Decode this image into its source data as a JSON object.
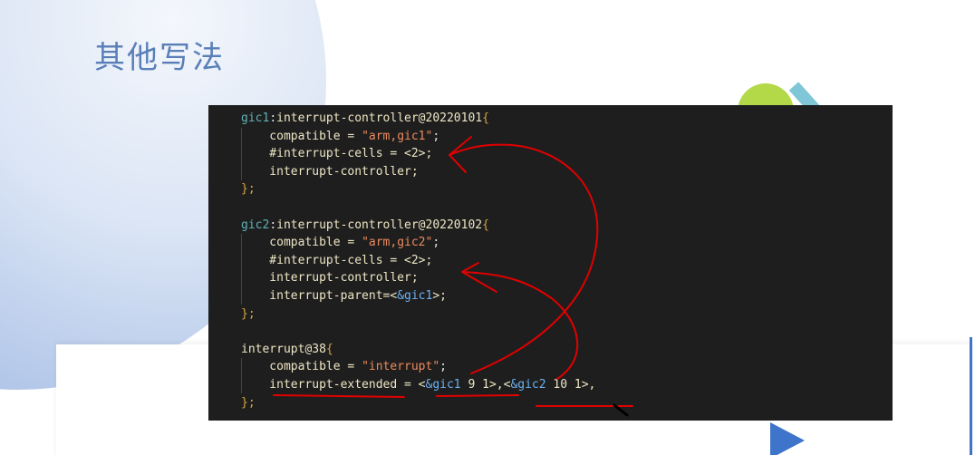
{
  "slide": {
    "title": "其他写法",
    "code": {
      "lines": [
        [
          [
            "name",
            "gic1"
          ],
          [
            "punc",
            ":"
          ],
          [
            "key",
            "interrupt-controller@20220101"
          ],
          [
            "brace",
            "{"
          ]
        ],
        [
          [
            "key",
            "    compatible = "
          ],
          [
            "str",
            "\"arm,gic1\""
          ],
          [
            "punc",
            ";"
          ]
        ],
        [
          [
            "key",
            "    #interrupt-cells = <2>;"
          ]
        ],
        [
          [
            "key",
            "    interrupt-controller;"
          ]
        ],
        [
          [
            "brace",
            "};"
          ]
        ],
        [],
        [
          [
            "name",
            "gic2"
          ],
          [
            "punc",
            ":"
          ],
          [
            "key",
            "interrupt-controller@20220102"
          ],
          [
            "brace",
            "{"
          ]
        ],
        [
          [
            "key",
            "    compatible = "
          ],
          [
            "str",
            "\"arm,gic2\""
          ],
          [
            "punc",
            ";"
          ]
        ],
        [
          [
            "key",
            "    #interrupt-cells = <2>;"
          ]
        ],
        [
          [
            "key",
            "    interrupt-controller;"
          ]
        ],
        [
          [
            "key",
            "    interrupt-parent=<"
          ],
          [
            "ref",
            "&gic1"
          ],
          [
            "key",
            ">;"
          ]
        ],
        [
          [
            "brace",
            "};"
          ]
        ],
        [],
        [
          [
            "key",
            "interrupt@38"
          ],
          [
            "brace",
            "{"
          ]
        ],
        [
          [
            "key",
            "    compatible = "
          ],
          [
            "str",
            "\"interrupt\""
          ],
          [
            "punc",
            ";"
          ]
        ],
        [
          [
            "key",
            "    interrupt-extended = <"
          ],
          [
            "ref",
            "&gic1"
          ],
          [
            "key",
            " 9 1>,<"
          ],
          [
            "ref",
            "&gic2"
          ],
          [
            "key",
            " 10 1>,"
          ]
        ],
        [
          [
            "brace",
            "};"
          ]
        ]
      ]
    },
    "colors": {
      "node_name": "#5fb2b9",
      "keyword": "#ede6c4",
      "string": "#ed8a5e",
      "reference": "#6cb0f0",
      "brace": "#d6a640",
      "annotation": "#e00000",
      "accent_blue": "#3e74c9",
      "accent_teal": "#7fc6d6",
      "accent_green": "#b3d848"
    }
  }
}
